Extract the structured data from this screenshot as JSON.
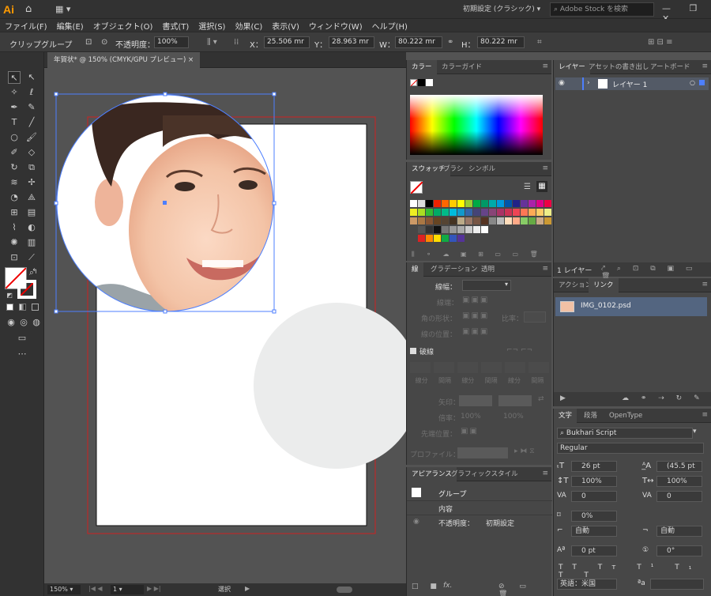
{
  "app": {
    "logo": "Ai",
    "workspace": "初期設定 (クラシック)",
    "stock_placeholder": "Adobe Stock を検索",
    "window_buttons": "— ❐ ✕"
  },
  "menu": [
    "ファイル(F)",
    "編集(E)",
    "オブジェクト(O)",
    "書式(T)",
    "選択(S)",
    "効果(C)",
    "表示(V)",
    "ウィンドウ(W)",
    "ヘルプ(H)"
  ],
  "control": {
    "mode": "クリップグループ",
    "opacity_label": "不透明度：",
    "opacity_value": "100%",
    "x_label": "X：",
    "x_value": "25.506 mr",
    "y_label": "Y：",
    "y_value": "28.963 mr",
    "w_label": "W：",
    "w_value": "80.222 mr",
    "h_label": "H：",
    "h_value": "80.222 mr"
  },
  "document": {
    "tab_title": "年賀状* @ 150% (CMYK/GPU プレビュー)",
    "zoom": "150%",
    "page": "1",
    "status": "選択"
  },
  "colors": {
    "accent_selection": "#4d7fff",
    "bleed": "#cc2222",
    "canvas": "#535353",
    "panel": "#474747"
  },
  "color_panel": {
    "tabs": [
      "カラー",
      "カラーガイド"
    ]
  },
  "swatches_panel": {
    "tabs": [
      "スウォッチ",
      "ブラシ",
      "シンボル"
    ]
  },
  "stroke_panel": {
    "tabs": [
      "線",
      "グラデーション",
      "透明"
    ],
    "weight_label": "線幅：",
    "cap_label": "線端：",
    "corner_label": "角の形状：",
    "ratio_label": "比率：",
    "align_label": "線の位置：",
    "dashed_label": "破線",
    "dash_labels": [
      "線分",
      "間隔",
      "線分",
      "間隔",
      "線分",
      "間隔"
    ],
    "arrow_label": "矢印：",
    "scale_label": "倍率：",
    "scale_values": [
      "100%",
      "100%"
    ],
    "align_arrow_label": "先端位置：",
    "profile_label": "プロファイル："
  },
  "appearance_panel": {
    "tabs": [
      "アピアランス",
      "グラフィックスタイル"
    ],
    "title": "グループ",
    "contents": "内容",
    "opacity_label": "不透明度：",
    "opacity_value": "初期設定",
    "fx": "fx."
  },
  "layers_panel": {
    "tabs": [
      "レイヤー",
      "アセットの書き出し",
      "アートボード"
    ],
    "layer_name": "レイヤー 1",
    "footer": "1 レイヤー"
  },
  "links_panel": {
    "tabs": [
      "アクション",
      "リンク"
    ],
    "file": "IMG_0102.psd"
  },
  "type_panel": {
    "tabs": [
      "文字",
      "段落",
      "OpenType"
    ],
    "font": "Bukhari Script",
    "style": "Regular",
    "size": "26 pt",
    "leading": "(45.5 pt",
    "v_scale": "100%",
    "h_scale": "100%",
    "kerning": "0",
    "tracking": "0",
    "tsume": "0%",
    "aki_left": "自動",
    "aki_right": "自動",
    "baseline": "0 pt",
    "rotation": "0°",
    "language": "英語：米国",
    "aa": "ªa"
  }
}
